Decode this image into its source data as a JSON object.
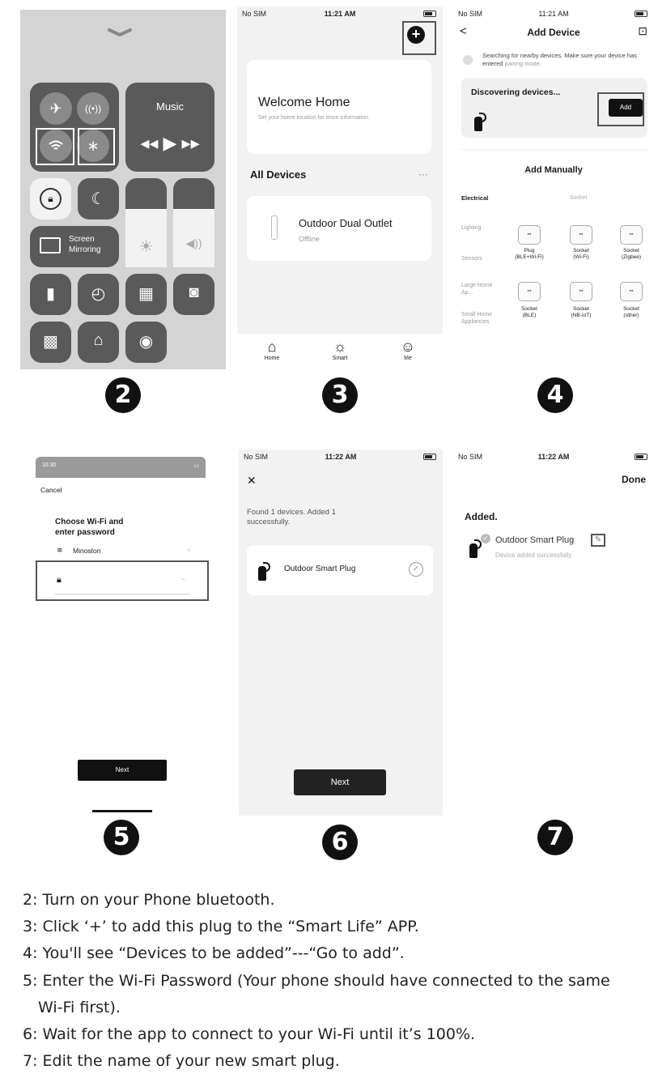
{
  "steps": {
    "s2": "2",
    "s3": "3",
    "s4": "4",
    "s5": "5",
    "s6": "6",
    "s7": "7"
  },
  "p2": {
    "music": "Music",
    "screen_mirroring": "Screen\nMirroring"
  },
  "p3": {
    "status_left": "No SIM",
    "status_time": "11:21 AM",
    "welcome": "Welcome Home",
    "welcome_sub": "Set your home location for more information",
    "all_devices": "All Devices",
    "more": "···",
    "device_name": "Outdoor Dual Outlet",
    "device_status": "Offline",
    "tabs": [
      "Home",
      "Smart",
      "Me"
    ]
  },
  "p4": {
    "status_left": "No SIM",
    "status_time": "11:21 AM",
    "back": "<",
    "title": "Add Device",
    "scan": "⊡",
    "searching": "Searching for nearby devices. Make sure your device has entered",
    "pairing": "pairing mode.",
    "discovering": "Discovering devices...",
    "add": "Add",
    "add_manually": "Add Manually",
    "categories": [
      "Electrical",
      "Lighting",
      "Sensors",
      "Large Home Ap...",
      "Small Home Appliances"
    ],
    "socket_header": "Socket",
    "items": [
      {
        "l1": "Plug",
        "l2": "(BLE+Wi-Fi)"
      },
      {
        "l1": "Socket",
        "l2": "(Wi-Fi)"
      },
      {
        "l1": "Socket",
        "l2": "(Zigbee)"
      },
      {
        "l1": "Socket",
        "l2": "(BLE)"
      },
      {
        "l1": "Socket",
        "l2": "(NB-IoT)"
      },
      {
        "l1": "Socket",
        "l2": "(other)"
      }
    ]
  },
  "p5": {
    "status_time": "16:30",
    "cancel": "Cancel",
    "choose": "Choose Wi-Fi and\nenter password",
    "wifi_name": "Minoston",
    "next": "Next"
  },
  "p6": {
    "status_left": "No SIM",
    "status_time": "11:22 AM",
    "close": "✕",
    "found": "Found 1 devices. Added 1\nsuccessfully.",
    "device": "Outdoor Smart Plug",
    "next": "Next"
  },
  "p7": {
    "status_left": "No SIM",
    "status_time": "11:22 AM",
    "done": "Done",
    "added": "Added.",
    "device": "Outdoor Smart Plug",
    "sub": "Device added successfully"
  },
  "instructions": [
    "2: Turn on your Phone bluetooth.",
    "3: Click ‘+’ to add this plug to the “Smart Life” APP.",
    "4: You'll see “Devices to be added”---“Go to add”.",
    "5: Enter the Wi-Fi Password (Your phone should have connected to the same",
    "Wi-Fi first).",
    "6: Wait for the app to connect to your Wi-Fi until it’s 100%.",
    "7: Edit the name of your new smart plug."
  ]
}
